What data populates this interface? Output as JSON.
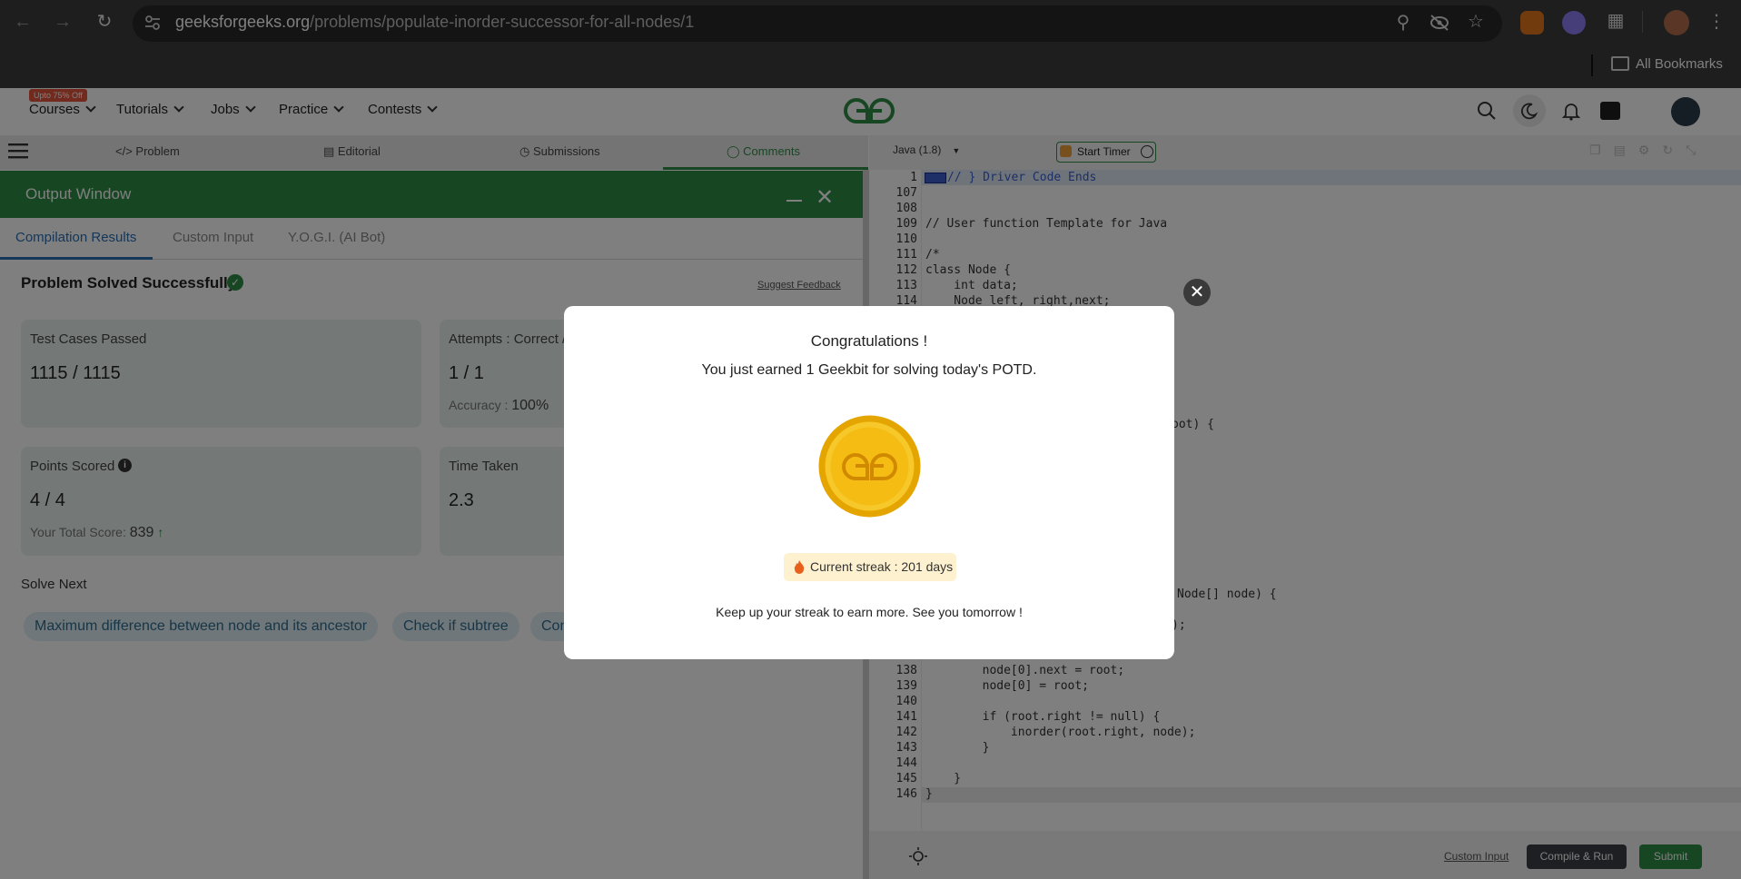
{
  "browser": {
    "url_domain": "geeksforgeeks.org",
    "url_path": "/problems/populate-inorder-successor-for-all-nodes/1",
    "all_bookmarks": "All Bookmarks"
  },
  "site": {
    "badge": "Upto 75% Off",
    "nav": [
      "Courses",
      "Tutorials",
      "Jobs",
      "Practice",
      "Contests"
    ]
  },
  "problem_tabs": [
    "Problem",
    "Editorial",
    "Submissions",
    "Comments"
  ],
  "editor": {
    "language": "Java (1.8)",
    "start_timer": "Start Timer",
    "lines": [
      {
        "n": "1",
        "t": "// } Driver Code Ends"
      },
      {
        "n": "107",
        "t": ""
      },
      {
        "n": "108",
        "t": ""
      },
      {
        "n": "109",
        "t": "// User function Template for Java"
      },
      {
        "n": "110",
        "t": ""
      },
      {
        "n": "111",
        "t": "/*"
      },
      {
        "n": "112",
        "t": "class Node {"
      },
      {
        "n": "113",
        "t": "    int data;"
      },
      {
        "n": "114",
        "t": "    Node left, right,next;"
      }
    ],
    "partial_lines": [
      {
        "t": "oot) {"
      },
      {
        "t": "Node[] node) {"
      },
      {
        "t": ");"
      }
    ],
    "lines_bottom": [
      {
        "n": "138",
        "t": "        node[0].next = root;"
      },
      {
        "n": "139",
        "t": "        node[0] = root;"
      },
      {
        "n": "140",
        "t": ""
      },
      {
        "n": "141",
        "t": "        if (root.right != null) {"
      },
      {
        "n": "142",
        "t": "            inorder(root.right, node);"
      },
      {
        "n": "143",
        "t": "        }"
      },
      {
        "n": "144",
        "t": ""
      },
      {
        "n": "145",
        "t": "    }"
      },
      {
        "n": "146",
        "t": "}"
      }
    ],
    "custom_input": "Custom Input",
    "compile_run": "Compile & Run",
    "submit": "Submit"
  },
  "output": {
    "title": "Output Window",
    "tabs": [
      "Compilation Results",
      "Custom Input",
      "Y.O.G.I. (AI Bot)"
    ],
    "status": "Problem Solved Successfully",
    "suggest_feedback": "Suggest Feedback",
    "test_cases_label": "Test Cases Passed",
    "test_cases_value": "1115 / 1115",
    "attempts_label": "Attempts : Correct /",
    "attempts_value": "1 / 1",
    "accuracy_label": "Accuracy :",
    "accuracy_value": "100%",
    "points_label": "Points Scored",
    "points_value": "4 / 4",
    "total_score_label": "Your Total Score:",
    "total_score_value": "839",
    "time_label": "Time Taken",
    "time_value": "2.3",
    "solve_next": "Solve Next",
    "chips": [
      "Maximum difference between node and its ancestor",
      "Check if subtree",
      "Con"
    ]
  },
  "modal": {
    "title": "Congratulations !",
    "message": "You just earned 1 Geekbit for solving today's POTD.",
    "streak": "Current streak : 201 days",
    "footer": "Keep up your streak to earn more. See you tomorrow !"
  },
  "colors": {
    "brand_green": "#2f8d46",
    "coin": "#f5c518"
  }
}
